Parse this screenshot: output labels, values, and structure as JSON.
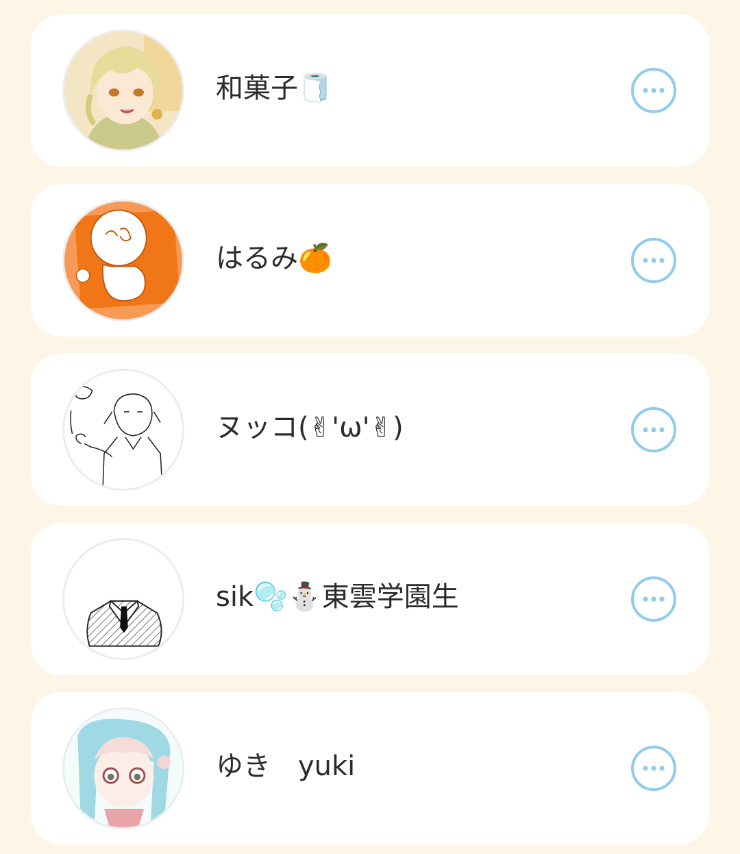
{
  "members": [
    {
      "name": "和菓子🧻",
      "avatar_icon": "anime-girl-blonde-avatar-icon",
      "more_icon": "more-horizontal-icon"
    },
    {
      "name": "はるみ🍊",
      "avatar_icon": "orange-sketch-avatar-icon",
      "more_icon": "more-horizontal-icon"
    },
    {
      "name": "ヌッコ(✌︎'ω'✌︎)",
      "avatar_icon": "line-art-girl-avatar-icon",
      "more_icon": "more-horizontal-icon"
    },
    {
      "name": "sik🫧⛄東雲学園生",
      "avatar_icon": "suit-and-tie-avatar-icon",
      "more_icon": "more-horizontal-icon"
    },
    {
      "name": "ゆき　yuki",
      "avatar_icon": "anime-girl-blue-hair-avatar-icon",
      "more_icon": "more-horizontal-icon"
    }
  ],
  "colors": {
    "background": "#fdf6e6",
    "card": "#ffffff",
    "accent": "#8fcbee",
    "text": "#2b2b2b"
  }
}
